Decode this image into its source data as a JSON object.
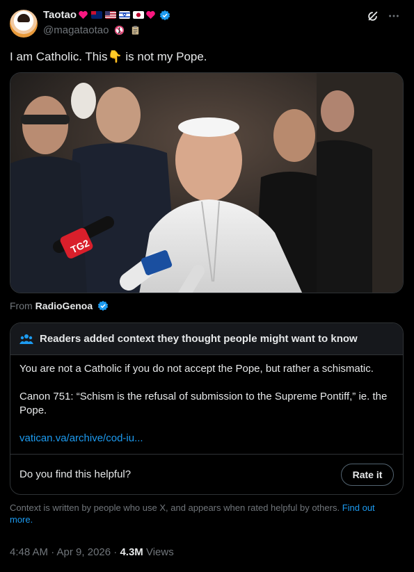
{
  "author": {
    "display_name": "Taotao",
    "handle": "@magataotao"
  },
  "tweet": {
    "text_before": "I am Catholic. This",
    "text_emoji": "👇",
    "text_after": " is not my Pope."
  },
  "media": {
    "source_prefix": "From",
    "source_name": "RadioGenoa",
    "mic_label": "TG2"
  },
  "community_note": {
    "header": "Readers added context they thought people might want to know",
    "paragraph_1": "You are not a Catholic if you do not accept the Pope, but rather a schismatic.",
    "paragraph_2": "Canon 751: “Schism is the refusal of submission to the Supreme Pontiff,” ie. the Pope.",
    "link": "vatican.va/archive/cod-iu...",
    "helpful_question": "Do you find this helpful?",
    "rate_label": "Rate it"
  },
  "context_footer": {
    "text": "Context is written by people who use X, and appears when rated helpful by others.",
    "link": "Find out more."
  },
  "meta": {
    "timestamp": "4:48 AM · Apr 9, 2026",
    "separator": " · ",
    "views_count": "4.3M",
    "views_label": " Views"
  },
  "colors": {
    "background": "#000000",
    "text": "#e7e9ea",
    "muted": "#71767b",
    "link": "#1d9bf0",
    "verified": "#1d9bf0",
    "heart": "#f91880"
  }
}
